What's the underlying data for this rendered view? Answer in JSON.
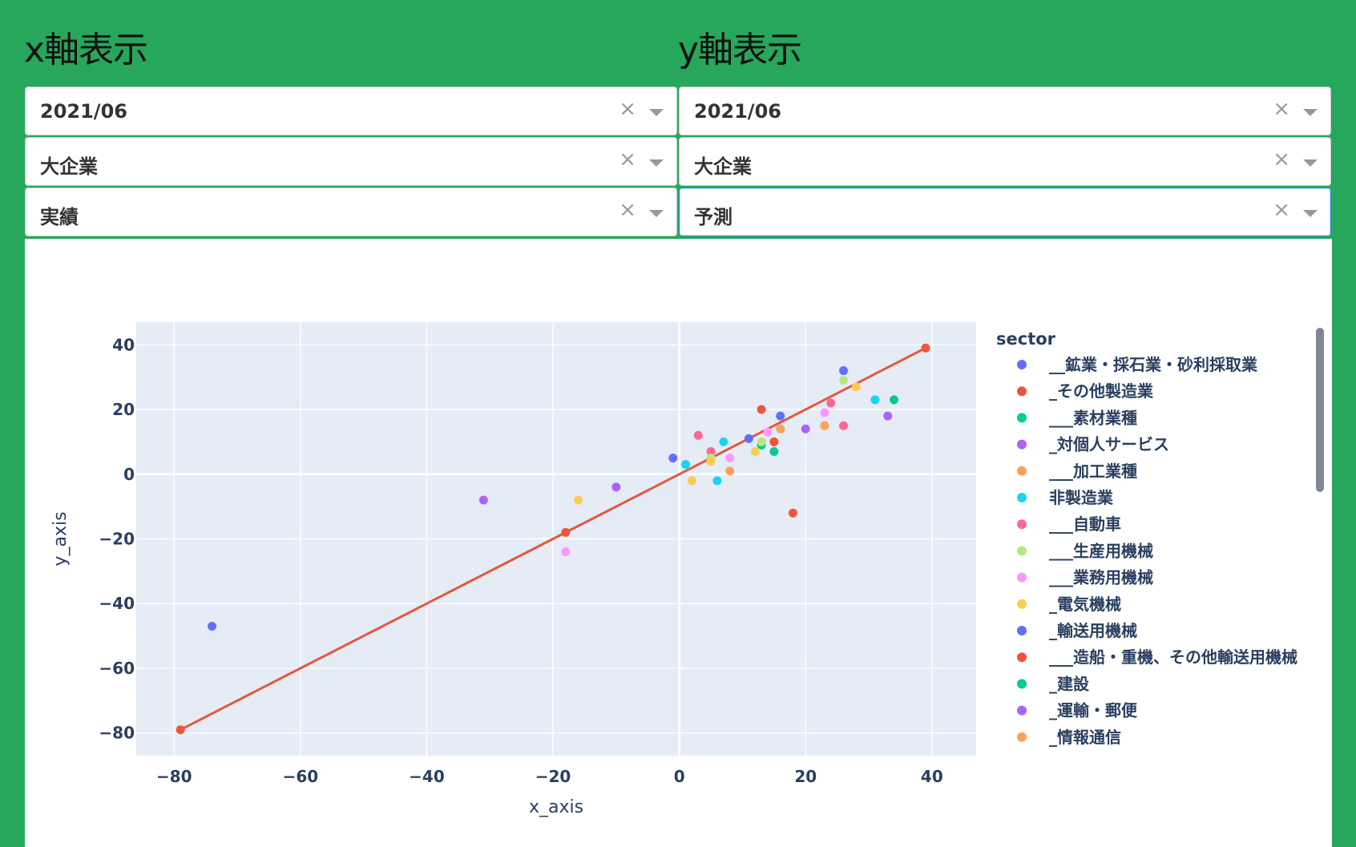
{
  "headers": {
    "x_title": "x軸表示",
    "y_title": "y軸表示"
  },
  "x_controls": [
    {
      "value": "2021/06"
    },
    {
      "value": "大企業"
    },
    {
      "value": "実績"
    }
  ],
  "y_controls": [
    {
      "value": "2021/06"
    },
    {
      "value": "大企業"
    },
    {
      "value": "予測"
    }
  ],
  "clear_glyph": "×",
  "chart_data": {
    "type": "scatter",
    "xlabel": "x_axis",
    "ylabel": "y_axis",
    "xlim": [
      -86,
      47
    ],
    "ylim": [
      -87,
      47
    ],
    "xticks": [
      -80,
      -60,
      -40,
      -20,
      0,
      20,
      40
    ],
    "yticks": [
      40,
      20,
      0,
      -20,
      -40,
      -60,
      -80
    ],
    "grid": true,
    "background": "#e5ecf6",
    "legend_title": "sector",
    "legend_placement": "right",
    "series": [
      {
        "name": "__鉱業・採石業・砂利採取業",
        "color": "#636efa",
        "points": [
          [
            -74,
            -47
          ],
          [
            16,
            18
          ],
          [
            26,
            32
          ],
          [
            -1,
            5
          ],
          [
            11,
            11
          ]
        ]
      },
      {
        "name": "_その他製造業",
        "color": "#ef553b",
        "points": [
          [
            39,
            39
          ],
          [
            -79,
            -79
          ],
          [
            -18,
            -18
          ],
          [
            13,
            20
          ],
          [
            18,
            -12
          ],
          [
            15,
            10
          ]
        ]
      },
      {
        "name": "___素材業種",
        "color": "#00cc96",
        "points": [
          [
            34,
            23
          ],
          [
            15,
            7
          ],
          [
            13,
            9
          ]
        ]
      },
      {
        "name": "_対個人サービス",
        "color": "#ab63fa",
        "points": [
          [
            -31,
            -8
          ],
          [
            -10,
            -4
          ],
          [
            20,
            14
          ],
          [
            33,
            18
          ]
        ]
      },
      {
        "name": "___加工業種",
        "color": "#ffa15a",
        "points": [
          [
            16,
            14
          ],
          [
            8,
            1
          ],
          [
            23,
            15
          ]
        ]
      },
      {
        "name": "非製造業",
        "color": "#19d3f3",
        "points": [
          [
            31,
            23
          ],
          [
            7,
            10
          ],
          [
            6,
            -2
          ],
          [
            1,
            3
          ]
        ]
      },
      {
        "name": "___自動車",
        "color": "#ff6692",
        "points": [
          [
            24,
            22
          ],
          [
            3,
            12
          ],
          [
            26,
            15
          ],
          [
            5,
            7
          ]
        ]
      },
      {
        "name": "___生産用機械",
        "color": "#b6e880",
        "points": [
          [
            26,
            29
          ],
          [
            13,
            10
          ],
          [
            5,
            5
          ]
        ]
      },
      {
        "name": "___業務用機械",
        "color": "#ff97ff",
        "points": [
          [
            -18,
            -24
          ],
          [
            23,
            19
          ],
          [
            8,
            5
          ],
          [
            14,
            13
          ]
        ]
      },
      {
        "name": "_電気機械",
        "color": "#fecb52",
        "points": [
          [
            -16,
            -8
          ],
          [
            28,
            27
          ],
          [
            2,
            -2
          ],
          [
            12,
            7
          ],
          [
            5,
            4
          ]
        ]
      },
      {
        "name": "_輸送用機械",
        "color": "#636efa",
        "points": []
      },
      {
        "name": "___造船・重機、その他輸送用機械",
        "color": "#ef553b",
        "points": []
      },
      {
        "name": "_建設",
        "color": "#00cc96",
        "points": []
      },
      {
        "name": "_運輸・郵便",
        "color": "#ab63fa",
        "points": []
      },
      {
        "name": "_情報通信",
        "color": "#ffa15a",
        "points": []
      }
    ],
    "trendline": {
      "color": "#e4583e",
      "points": [
        [
          -79,
          -79
        ],
        [
          39,
          39
        ]
      ]
    }
  }
}
